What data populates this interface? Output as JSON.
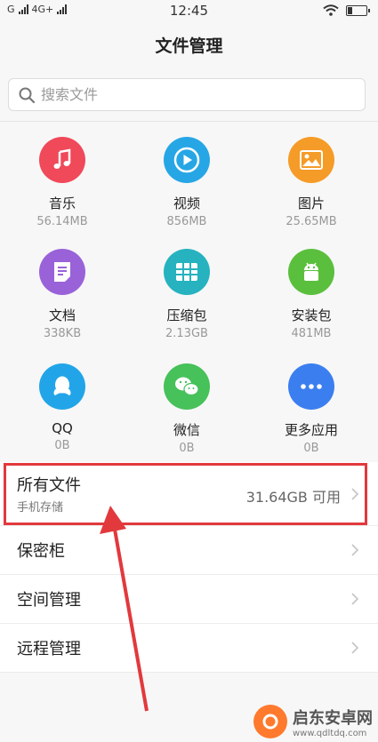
{
  "status": {
    "carrier": "G",
    "network": "4G+",
    "time": "12:45"
  },
  "header": {
    "title": "文件管理"
  },
  "search": {
    "placeholder": "搜索文件"
  },
  "categories": [
    {
      "name": "音乐",
      "size": "56.14MB",
      "color": "#f0495a",
      "icon": "music-icon"
    },
    {
      "name": "视频",
      "size": "856MB",
      "color": "#27a6e5",
      "icon": "video-play-icon"
    },
    {
      "name": "图片",
      "size": "25.65MB",
      "color": "#f59b27",
      "icon": "picture-icon"
    },
    {
      "name": "文档",
      "size": "338KB",
      "color": "#9a62d8",
      "icon": "document-icon"
    },
    {
      "name": "压缩包",
      "size": "2.13GB",
      "color": "#26b2bf",
      "icon": "archive-icon"
    },
    {
      "name": "安装包",
      "size": "481MB",
      "color": "#5bbf3e",
      "icon": "android-icon"
    },
    {
      "name": "QQ",
      "size": "0B",
      "color": "#22a5e8",
      "icon": "qq-icon"
    },
    {
      "name": "微信",
      "size": "0B",
      "color": "#47c15a",
      "icon": "wechat-icon"
    },
    {
      "name": "更多应用",
      "size": "0B",
      "color": "#3b7ef0",
      "icon": "more-dots-icon"
    }
  ],
  "list": {
    "all_files": {
      "label": "所有文件",
      "sub": "手机存储",
      "free": "31.64GB 可用"
    },
    "items": [
      {
        "label": "保密柜"
      },
      {
        "label": "空间管理"
      },
      {
        "label": "远程管理"
      }
    ]
  },
  "colors": {
    "highlight": "#e2393d"
  },
  "watermark": {
    "name": "启东安卓网",
    "url": "www.qdltdq.com"
  }
}
